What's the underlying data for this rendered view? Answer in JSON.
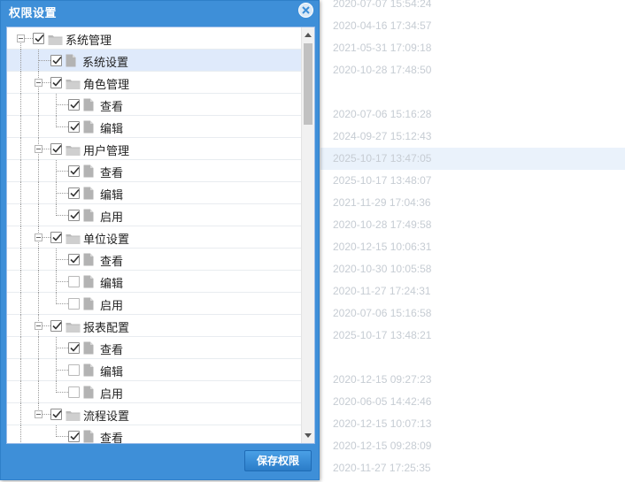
{
  "background_table": {
    "timestamps": [
      "2020-07-07 15:54:24",
      "2020-04-16 17:34:57",
      "2021-05-31 17:09:18",
      "2020-10-28 17:48:50",
      "",
      "2020-07-06 15:16:28",
      "2024-09-27 15:12:43",
      "2025-10-17 13:47:05",
      "2025-10-17 13:48:07",
      "2021-11-29 17:04:36",
      "2020-10-28 17:49:58",
      "2020-12-15 10:06:31",
      "2020-10-30 10:05:58",
      "2020-11-27 17:24:31",
      "2020-07-06 15:16:58",
      "2025-10-17 13:48:21",
      "",
      "2020-12-15 09:27:23",
      "2020-06-05 14:42:46",
      "2020-12-15 10:07:13",
      "2020-12-15 09:28:09",
      "2020-11-27 17:25:35"
    ],
    "selected_row_index": 7
  },
  "dialog": {
    "title": "权限设置",
    "close_icon": "close-icon",
    "save_label": "保存权限",
    "accent_color": "#3e8fd8"
  },
  "tree": {
    "nodes": [
      {
        "label": "系统管理",
        "checked": true,
        "type": "folder",
        "depth": 0,
        "expanded": true,
        "selected": false
      },
      {
        "label": "系统设置",
        "checked": true,
        "type": "file",
        "depth": 1,
        "selected": true
      },
      {
        "label": "角色管理",
        "checked": true,
        "type": "folder",
        "depth": 1,
        "expanded": true,
        "selected": false
      },
      {
        "label": "查看",
        "checked": true,
        "type": "file",
        "depth": 2,
        "selected": false
      },
      {
        "label": "编辑",
        "checked": true,
        "type": "file",
        "depth": 2,
        "selected": false
      },
      {
        "label": "用户管理",
        "checked": true,
        "type": "folder",
        "depth": 1,
        "expanded": true,
        "selected": false
      },
      {
        "label": "查看",
        "checked": true,
        "type": "file",
        "depth": 2,
        "selected": false
      },
      {
        "label": "编辑",
        "checked": true,
        "type": "file",
        "depth": 2,
        "selected": false
      },
      {
        "label": "启用",
        "checked": true,
        "type": "file",
        "depth": 2,
        "selected": false
      },
      {
        "label": "单位设置",
        "checked": true,
        "type": "folder",
        "depth": 1,
        "expanded": true,
        "selected": false
      },
      {
        "label": "查看",
        "checked": true,
        "type": "file",
        "depth": 2,
        "selected": false
      },
      {
        "label": "编辑",
        "checked": false,
        "type": "file",
        "depth": 2,
        "selected": false
      },
      {
        "label": "启用",
        "checked": false,
        "type": "file",
        "depth": 2,
        "selected": false
      },
      {
        "label": "报表配置",
        "checked": true,
        "type": "folder",
        "depth": 1,
        "expanded": true,
        "selected": false
      },
      {
        "label": "查看",
        "checked": true,
        "type": "file",
        "depth": 2,
        "selected": false
      },
      {
        "label": "编辑",
        "checked": false,
        "type": "file",
        "depth": 2,
        "selected": false
      },
      {
        "label": "启用",
        "checked": false,
        "type": "file",
        "depth": 2,
        "selected": false
      },
      {
        "label": "流程设置",
        "checked": true,
        "type": "folder",
        "depth": 1,
        "expanded": true,
        "selected": false
      },
      {
        "label": "查看",
        "checked": true,
        "type": "file",
        "depth": 2,
        "selected": false
      }
    ]
  }
}
